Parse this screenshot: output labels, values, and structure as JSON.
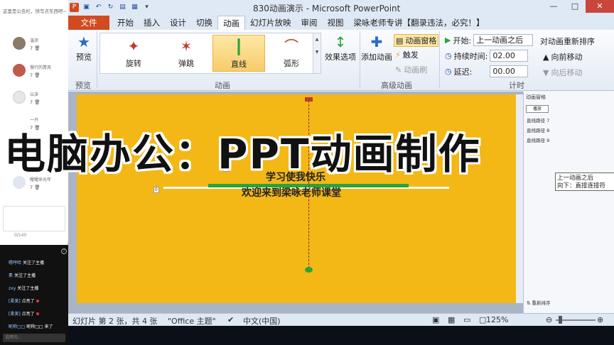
{
  "chat": {
    "header": "这里是公告栏，快写点东西吧~",
    "users": [
      {
        "name": "温凉",
        "likes": "7"
      },
      {
        "name": "慢行的青风",
        "likes": "7"
      },
      {
        "name": "以沫",
        "likes": "7"
      },
      {
        "name": "一只",
        "likes": "7"
      },
      {
        "name": "喔喔命光年",
        "likes": "7"
      }
    ],
    "char_count": "0/140",
    "danmu": [
      {
        "user": "嗯哼哈",
        "text": "关注了主播"
      },
      {
        "user": "素",
        "text": "关注了主播"
      },
      {
        "user": "zxy",
        "text": "关注了主播"
      },
      {
        "user": "[柔美]",
        "text": "点亮了"
      },
      {
        "user": "[柔美]",
        "text": "点亮了"
      },
      {
        "user": "昵称□□",
        "text": "昵称□□ 来了"
      }
    ],
    "input_placeholder": "说两句..."
  },
  "window": {
    "title": "830动画演示 - Microsoft PowerPoint",
    "controls": {
      "minimize": "—",
      "maximize": "□",
      "close": "✕"
    }
  },
  "tabs": [
    {
      "label": "文件"
    },
    {
      "label": "开始"
    },
    {
      "label": "插入"
    },
    {
      "label": "设计"
    },
    {
      "label": "切换"
    },
    {
      "label": "动画"
    },
    {
      "label": "幻灯片放映"
    },
    {
      "label": "审阅"
    },
    {
      "label": "视图"
    },
    {
      "label": "梁咏老师专讲【翻录违法，必究！】"
    }
  ],
  "ribbon": {
    "preview": {
      "label": "预览",
      "group": "预览"
    },
    "animations": [
      {
        "label": "旋转",
        "icon": "spin-star-icon"
      },
      {
        "label": "弹跳",
        "icon": "bounce-star-icon"
      },
      {
        "label": "直线",
        "icon": "line-path-icon"
      },
      {
        "label": "弧形",
        "icon": "arc-path-icon"
      }
    ],
    "animation_group": "动画",
    "effect_options": "效果选项",
    "add_animation": "添加动画",
    "animation_pane": "动画窗格",
    "trigger": "触发",
    "animation_painter": "动画刷",
    "advanced_group": "高级动画",
    "start_label": "开始:",
    "start_value": "上一动画之后",
    "duration_label": "持续时间:",
    "duration_value": "02.00",
    "delay_label": "延迟:",
    "delay_value": "00.00",
    "timing_group": "计时",
    "reorder_title": "对动画重新排序",
    "move_earlier": "向前移动",
    "move_later": "向后移动"
  },
  "slide": {
    "line1": "学习使我快乐",
    "line2": "欢迎来到梁咏老师课堂",
    "tags": [
      "0",
      "0"
    ]
  },
  "anim_pane": {
    "title": "动画窗格",
    "play": "播放",
    "rows": [
      "直线路径 7",
      "直线路径 8",
      "直线路径 9"
    ],
    "tooltip_line1": "上一动画之后",
    "tooltip_line2": "向下：直接连接符",
    "reorder": "重新排序"
  },
  "status": {
    "slide": "幻灯片 第 2 张，共 4 张",
    "theme": "\"Office 主题\"",
    "language": "中文(中国)",
    "zoom": "125%"
  },
  "headline": "电脑办公：PPT动画制作"
}
